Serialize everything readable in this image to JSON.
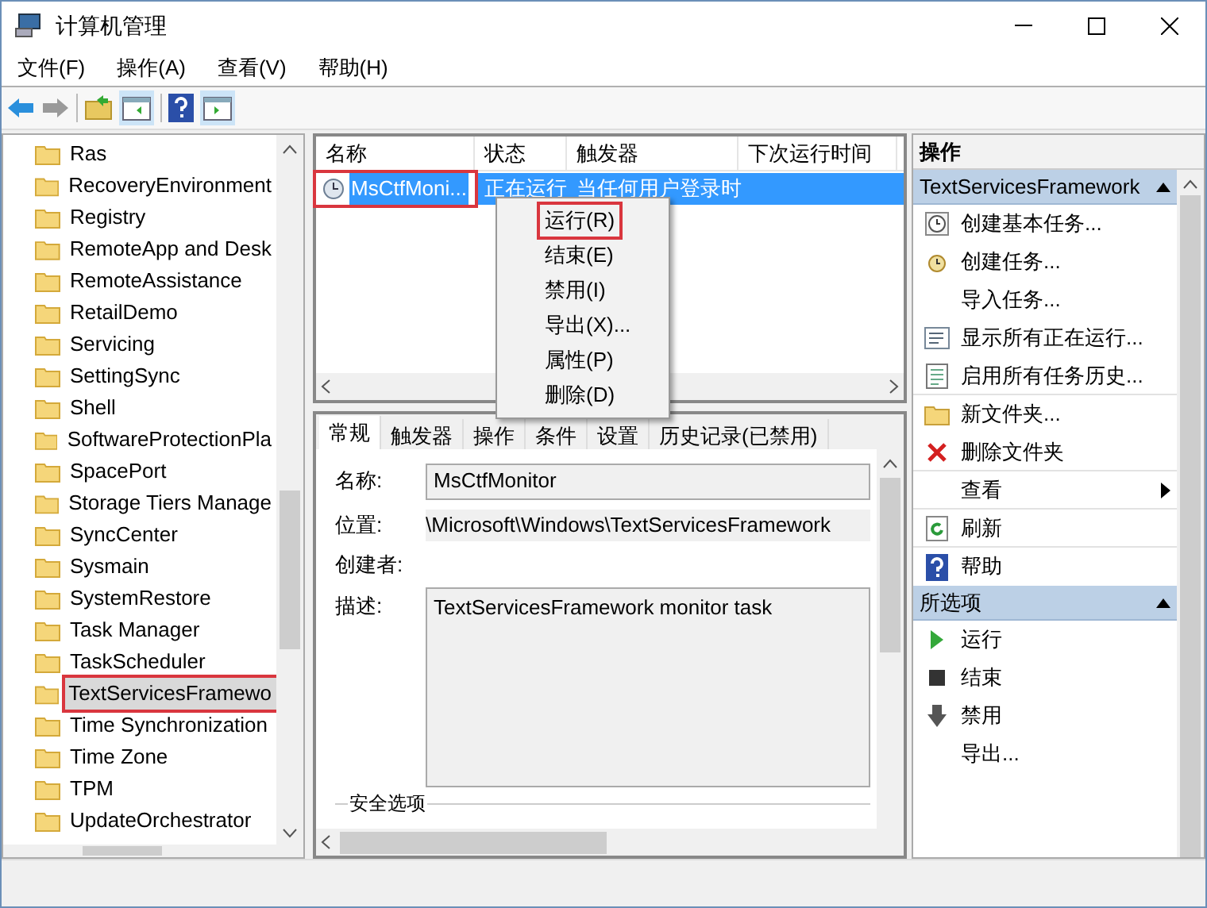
{
  "window": {
    "title": "计算机管理"
  },
  "menu": [
    "文件(F)",
    "操作(A)",
    "查看(V)",
    "帮助(H)"
  ],
  "tree": [
    {
      "label": "Ras",
      "highlighted": false
    },
    {
      "label": "RecoveryEnvironment",
      "highlighted": false
    },
    {
      "label": "Registry",
      "highlighted": false
    },
    {
      "label": "RemoteApp and Desk",
      "highlighted": false
    },
    {
      "label": "RemoteAssistance",
      "highlighted": false
    },
    {
      "label": "RetailDemo",
      "highlighted": false
    },
    {
      "label": "Servicing",
      "highlighted": false
    },
    {
      "label": "SettingSync",
      "highlighted": false
    },
    {
      "label": "Shell",
      "highlighted": false
    },
    {
      "label": "SoftwareProtectionPla",
      "highlighted": false
    },
    {
      "label": "SpacePort",
      "highlighted": false
    },
    {
      "label": "Storage Tiers Manage",
      "highlighted": false
    },
    {
      "label": "SyncCenter",
      "highlighted": false
    },
    {
      "label": "Sysmain",
      "highlighted": false
    },
    {
      "label": "SystemRestore",
      "highlighted": false
    },
    {
      "label": "Task Manager",
      "highlighted": false
    },
    {
      "label": "TaskScheduler",
      "highlighted": false
    },
    {
      "label": "TextServicesFramewo",
      "highlighted": true
    },
    {
      "label": "Time Synchronization",
      "highlighted": false
    },
    {
      "label": "Time Zone",
      "highlighted": false
    },
    {
      "label": "TPM",
      "highlighted": false
    },
    {
      "label": "UpdateOrchestrator",
      "highlighted": false
    }
  ],
  "tasks": {
    "columns": [
      "名称",
      "状态",
      "触发器",
      "下次运行时间"
    ],
    "rows": [
      {
        "name": "MsCtfMoni...",
        "status": "正在运行",
        "trigger": "当任何用户登录时",
        "selected": true,
        "highlighted": true
      }
    ]
  },
  "context_menu": [
    {
      "label": "运行(R)",
      "highlighted": true
    },
    {
      "label": "结束(E)",
      "highlighted": false
    },
    {
      "label": "禁用(I)",
      "highlighted": false
    },
    {
      "label": "导出(X)...",
      "highlighted": false
    },
    {
      "label": "属性(P)",
      "highlighted": false
    },
    {
      "label": "删除(D)",
      "highlighted": false
    }
  ],
  "detail_tabs": [
    {
      "label": "常规",
      "selected": true
    },
    {
      "label": "触发器",
      "selected": false
    },
    {
      "label": "操作",
      "selected": false
    },
    {
      "label": "条件",
      "selected": false
    },
    {
      "label": "设置",
      "selected": false
    },
    {
      "label": "历史记录(已禁用)",
      "selected": false
    }
  ],
  "detail": {
    "name_label": "名称:",
    "name": "MsCtfMonitor",
    "location_label": "位置:",
    "location": "\\Microsoft\\Windows\\TextServicesFramework",
    "author_label": "创建者:",
    "description_label": "描述:",
    "description": "TextServicesFramework monitor task",
    "security_label": "安全选项"
  },
  "actions": {
    "title": "操作",
    "groups": [
      {
        "title": "TextServicesFramework",
        "items": [
          {
            "kind": "clock",
            "label": "创建基本任务...",
            "separator": false
          },
          {
            "kind": "task",
            "label": "创建任务...",
            "separator": false
          },
          {
            "kind": "none",
            "label": "导入任务...",
            "separator": false
          },
          {
            "kind": "list",
            "label": "显示所有正在运行...",
            "separator": false
          },
          {
            "kind": "doc",
            "label": "启用所有任务历史...",
            "separator": true
          },
          {
            "kind": "folder",
            "label": "新文件夹...",
            "separator": false
          },
          {
            "kind": "delete",
            "label": "删除文件夹",
            "separator": true
          },
          {
            "kind": "submenu",
            "label": "查看",
            "separator": true
          },
          {
            "kind": "refresh",
            "label": "刷新",
            "separator": true
          },
          {
            "kind": "help",
            "label": "帮助",
            "separator": false
          }
        ]
      },
      {
        "title": "所选项",
        "items": [
          {
            "kind": "run",
            "label": "运行",
            "separator": false
          },
          {
            "kind": "stop",
            "label": "结束",
            "separator": false
          },
          {
            "kind": "disable",
            "label": "禁用",
            "separator": false
          },
          {
            "kind": "none",
            "label": "导出...",
            "separator": false
          }
        ]
      }
    ]
  }
}
